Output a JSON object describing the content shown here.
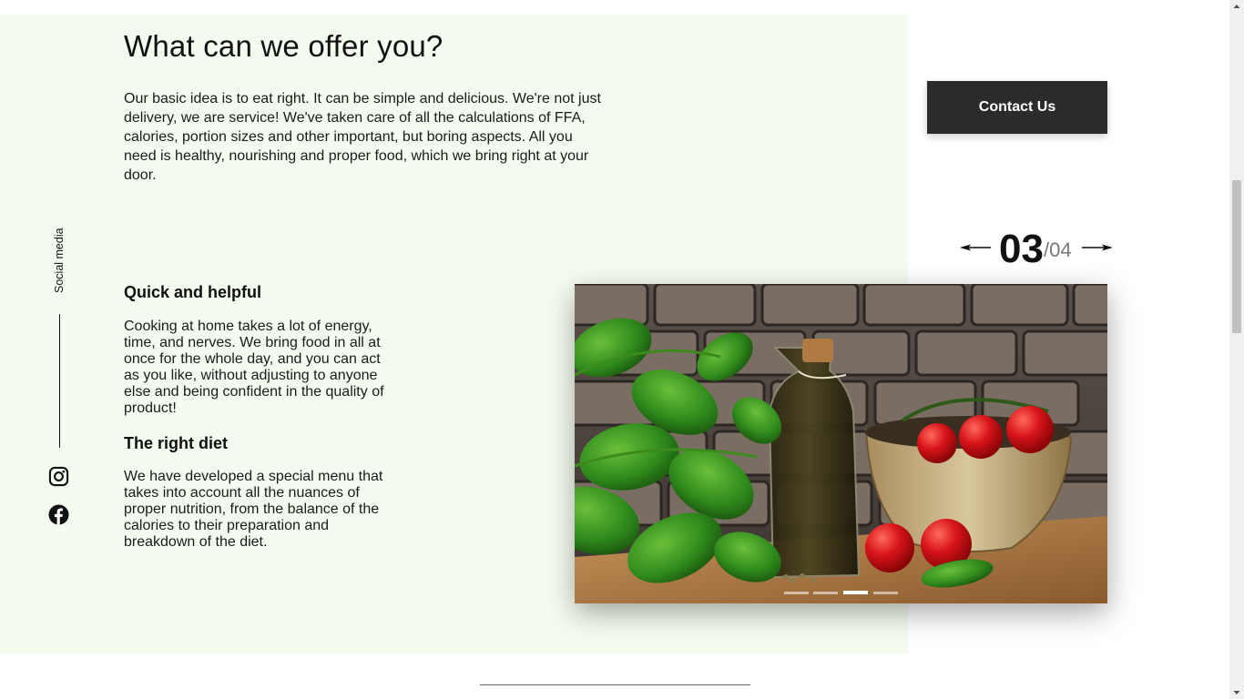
{
  "section": {
    "title": "What can we offer you?",
    "intro": "Our basic idea is to eat right. It can be simple and delicious. We're not just delivery, we are service! We've taken care of all the calculations of FFA, calories, portion sizes and other important, but boring aspects. All you need is healthy, nourishing and proper food, which we bring right at your door."
  },
  "social": {
    "label": "Social media",
    "icons": [
      "instagram-icon",
      "facebook-icon"
    ]
  },
  "features": [
    {
      "title": "Quick and helpful",
      "text": "Cooking at home takes a lot of energy, time, and nerves. We bring food in all at once for the whole day, and you can act as you like, without adjusting to anyone else and being confident in the quality of product!"
    },
    {
      "title": "The right diet",
      "text": "We have developed a special menu that takes into account all the nuances of proper nutrition, from the balance of the calories to their preparation and breakdown of the diet."
    }
  ],
  "contact": {
    "label": "Contact Us"
  },
  "slider": {
    "current": "03",
    "total": "/04",
    "active_index": 2,
    "slide_count": 4,
    "icons": [
      "arrow-left-icon",
      "arrow-right-icon"
    ]
  },
  "colors": {
    "panel_bg": "#f5fcef",
    "button_bg": "#2b2b2b",
    "button_text": "#ffffff",
    "text": "#111111"
  }
}
